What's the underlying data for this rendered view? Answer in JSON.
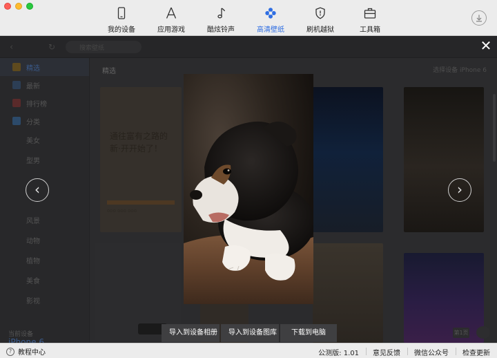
{
  "window": {
    "controls": [
      "close",
      "minimize",
      "zoom"
    ]
  },
  "nav": {
    "items": [
      {
        "label": "我的设备",
        "icon": "phone-icon"
      },
      {
        "label": "应用游戏",
        "icon": "app-store-icon"
      },
      {
        "label": "酷炫铃声",
        "icon": "music-note-icon"
      },
      {
        "label": "高清壁纸",
        "icon": "flower-icon",
        "active": true
      },
      {
        "label": "刷机越狱",
        "icon": "shield-icon"
      },
      {
        "label": "工具箱",
        "icon": "toolbox-icon"
      }
    ],
    "download_icon": "download-icon",
    "active_color": "#2f6ee2"
  },
  "subbar": {
    "search_placeholder": "搜索壁纸"
  },
  "sidebar": {
    "items": [
      {
        "label": "精选",
        "icon": "crown-icon",
        "active": true
      },
      {
        "label": "最新",
        "icon": "pencil-icon"
      },
      {
        "label": "排行榜",
        "icon": "trophy-icon"
      },
      {
        "label": "分类",
        "icon": "grid-icon"
      }
    ],
    "categories": [
      "美女",
      "型男",
      "",
      "",
      "风景",
      "动物",
      "植物",
      "美食",
      "影视"
    ],
    "device_label": "当前设备",
    "device_name": "iPhone 6",
    "device_sub": "iPhone"
  },
  "content": {
    "title": "精选",
    "device_select": "选择设备 iPhone 6",
    "card_drawing_title": "通往富有之路的\n新·开开始了！",
    "card_drawing_foot": "ooo ooo ooo",
    "page_badge": "第1页"
  },
  "viewer": {
    "close_icon": "close-icon",
    "prev_icon": "chevron-left-icon",
    "next_icon": "chevron-right-icon",
    "image": "puppy-photo",
    "actions": [
      "导入到设备相册",
      "导入到设备图库",
      "下载到电脑"
    ]
  },
  "statusbar": {
    "tutorial": "教程中心",
    "version": "公测版: 1.01",
    "feedback": "意见反馈",
    "wechat": "微信公众号",
    "update": "检查更新"
  }
}
